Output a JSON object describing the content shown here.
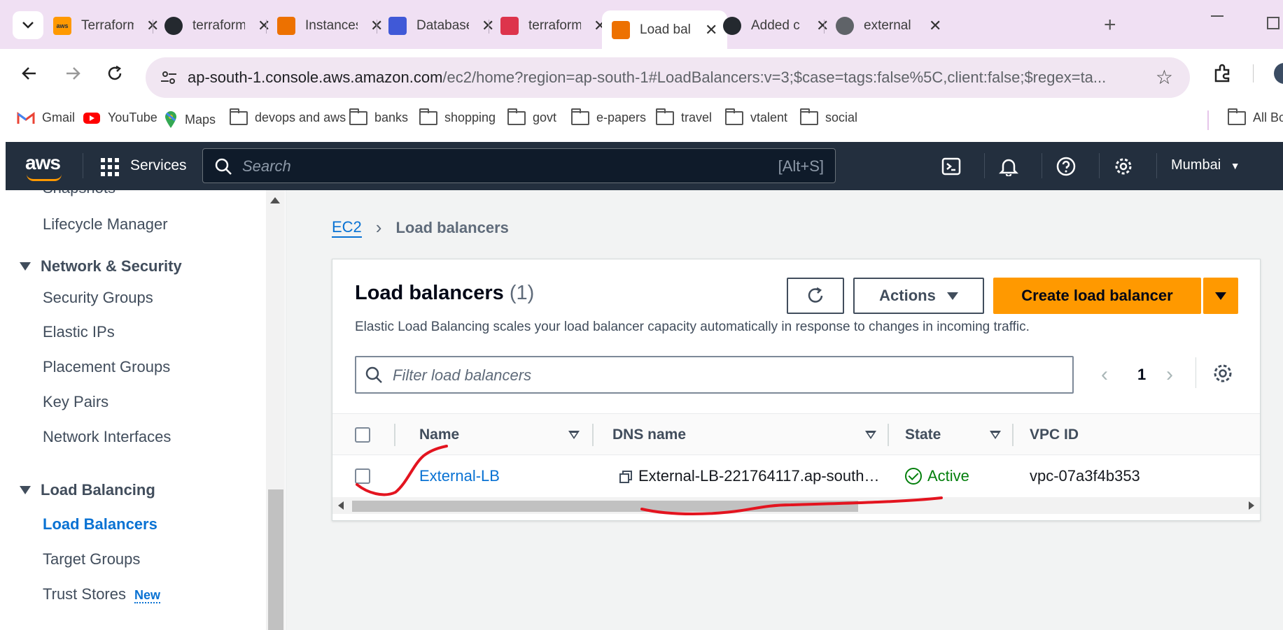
{
  "browser": {
    "tabs": [
      {
        "title": "Terraform",
        "icon": "aws-icon",
        "color": "#ff9900"
      },
      {
        "title": "terraform",
        "icon": "github-icon",
        "color": "#24292f"
      },
      {
        "title": "Instances",
        "icon": "ec2-icon",
        "color": "#ed7100"
      },
      {
        "title": "Database",
        "icon": "rds-icon",
        "color": "#4059d7"
      },
      {
        "title": "terraform",
        "icon": "registry-icon",
        "color": "#dd344c"
      },
      {
        "title": "Load bal",
        "icon": "ec2-icon",
        "color": "#ed7100",
        "active": true
      },
      {
        "title": "Added c",
        "icon": "github-icon",
        "color": "#24292f"
      },
      {
        "title": "external",
        "icon": "globe-icon",
        "color": "#5f6368"
      }
    ],
    "url_host": "ap-south-1.console.aws.amazon.com",
    "url_path": "/ec2/home?region=ap-south-1#LoadBalancers:v=3;$case=tags:false%5C,client:false;$regex=ta...",
    "bookmarks": [
      {
        "label": "Gmail",
        "icon": "gmail-icon"
      },
      {
        "label": "YouTube",
        "icon": "youtube-icon"
      },
      {
        "label": "Maps",
        "icon": "maps-icon"
      },
      {
        "label": "devops and aws",
        "icon": "folder-icon"
      },
      {
        "label": "banks",
        "icon": "folder-icon"
      },
      {
        "label": "shopping",
        "icon": "folder-icon"
      },
      {
        "label": "govt",
        "icon": "folder-icon"
      },
      {
        "label": "e-papers",
        "icon": "folder-icon"
      },
      {
        "label": "travel",
        "icon": "folder-icon"
      },
      {
        "label": "vtalent",
        "icon": "folder-icon"
      },
      {
        "label": "social",
        "icon": "folder-icon"
      }
    ],
    "bookmarks_all": "All Bo"
  },
  "aws_nav": {
    "logo": "aws",
    "services": "Services",
    "search_placeholder": "Search",
    "search_shortcut": "[Alt+S]",
    "region": "Mumbai"
  },
  "sidebar": {
    "partial_item": "Snapshots",
    "lifecycle": "Lifecycle Manager",
    "network_section": "Network & Security",
    "network_items": [
      "Security Groups",
      "Elastic IPs",
      "Placement Groups",
      "Key Pairs",
      "Network Interfaces"
    ],
    "lb_section": "Load Balancing",
    "lb_items": [
      "Load Balancers",
      "Target Groups",
      "Trust Stores"
    ],
    "new_badge": "New"
  },
  "breadcrumb": {
    "root": "EC2",
    "current": "Load balancers"
  },
  "panel": {
    "title": "Load balancers",
    "count": "(1)",
    "description": "Elastic Load Balancing scales your load balancer capacity automatically in response to changes in incoming traffic.",
    "actions_label": "Actions",
    "create_label": "Create load balancer",
    "filter_placeholder": "Filter load balancers",
    "page_number": "1"
  },
  "table": {
    "columns": [
      "Name",
      "DNS name",
      "State",
      "VPC ID"
    ],
    "rows": [
      {
        "name": "External-LB",
        "dns": "External-LB-221764117.ap-south…",
        "state": "Active",
        "vpc": "vpc-07a3f4b353"
      }
    ]
  },
  "colors": {
    "aws_nav_bg": "#232f3e",
    "aws_orange": "#ff9900",
    "link_blue": "#0972d3",
    "active_green": "#037f0c",
    "annotation_red": "#e3141f"
  }
}
